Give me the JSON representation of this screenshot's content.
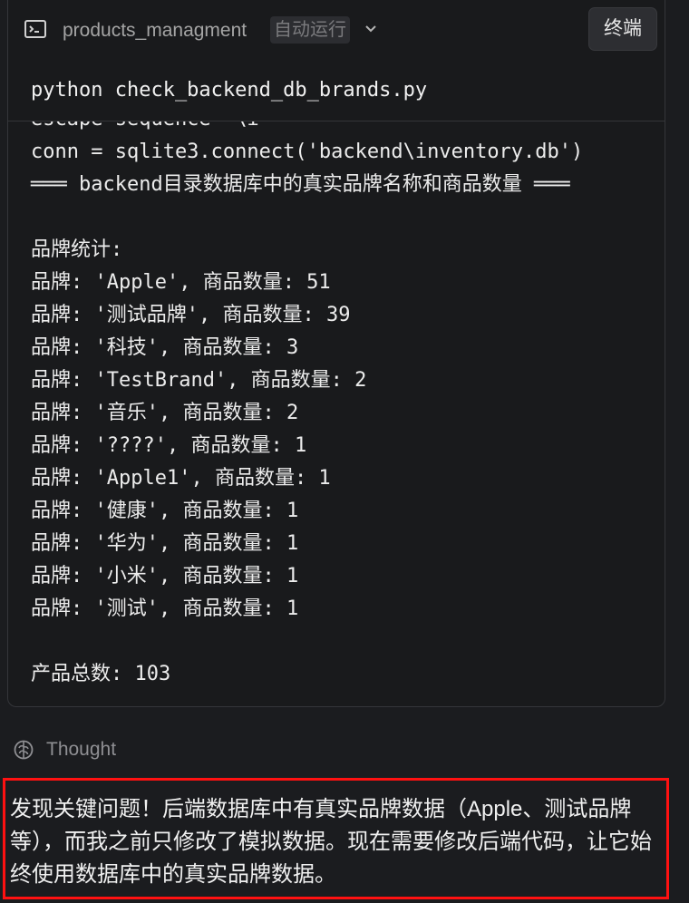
{
  "header": {
    "project_name": "products_managment",
    "auto_run_label": "自动运行",
    "terminal_button_label": "终端"
  },
  "command": "python check_backend_db_brands.py",
  "output_lines": [
    "escape sequence '\\i'",
    "conn = sqlite3.connect('backend\\inventory.db')",
    "═══ backend目录数据库中的真实品牌名称和商品数量 ═══",
    "",
    "品牌统计:",
    "品牌: 'Apple', 商品数量: 51",
    "品牌: '测试品牌', 商品数量: 39",
    "品牌: '科技', 商品数量: 3",
    "品牌: 'TestBrand', 商品数量: 2",
    "品牌: '音乐', 商品数量: 2",
    "品牌: '????', 商品数量: 1",
    "品牌: 'Apple1', 商品数量: 1",
    "品牌: '健康', 商品数量: 1",
    "品牌: '华为', 商品数量: 1",
    "品牌: '小米', 商品数量: 1",
    "品牌: '测试', 商品数量: 1",
    "",
    "产品总数: 103"
  ],
  "thought_label": "Thought",
  "message": "发现关键问题！后端数据库中有真实品牌数据（Apple、测试品牌等），而我之前只修改了模拟数据。现在需要修改后端代码，让它始终使用数据库中的真实品牌数据。",
  "icons": {
    "terminal": "terminal-icon",
    "chevron": "chevron-down-icon",
    "thought": "brain-icon"
  },
  "colors": {
    "background": "#1b1c1f",
    "highlight_border": "#ff1111"
  }
}
